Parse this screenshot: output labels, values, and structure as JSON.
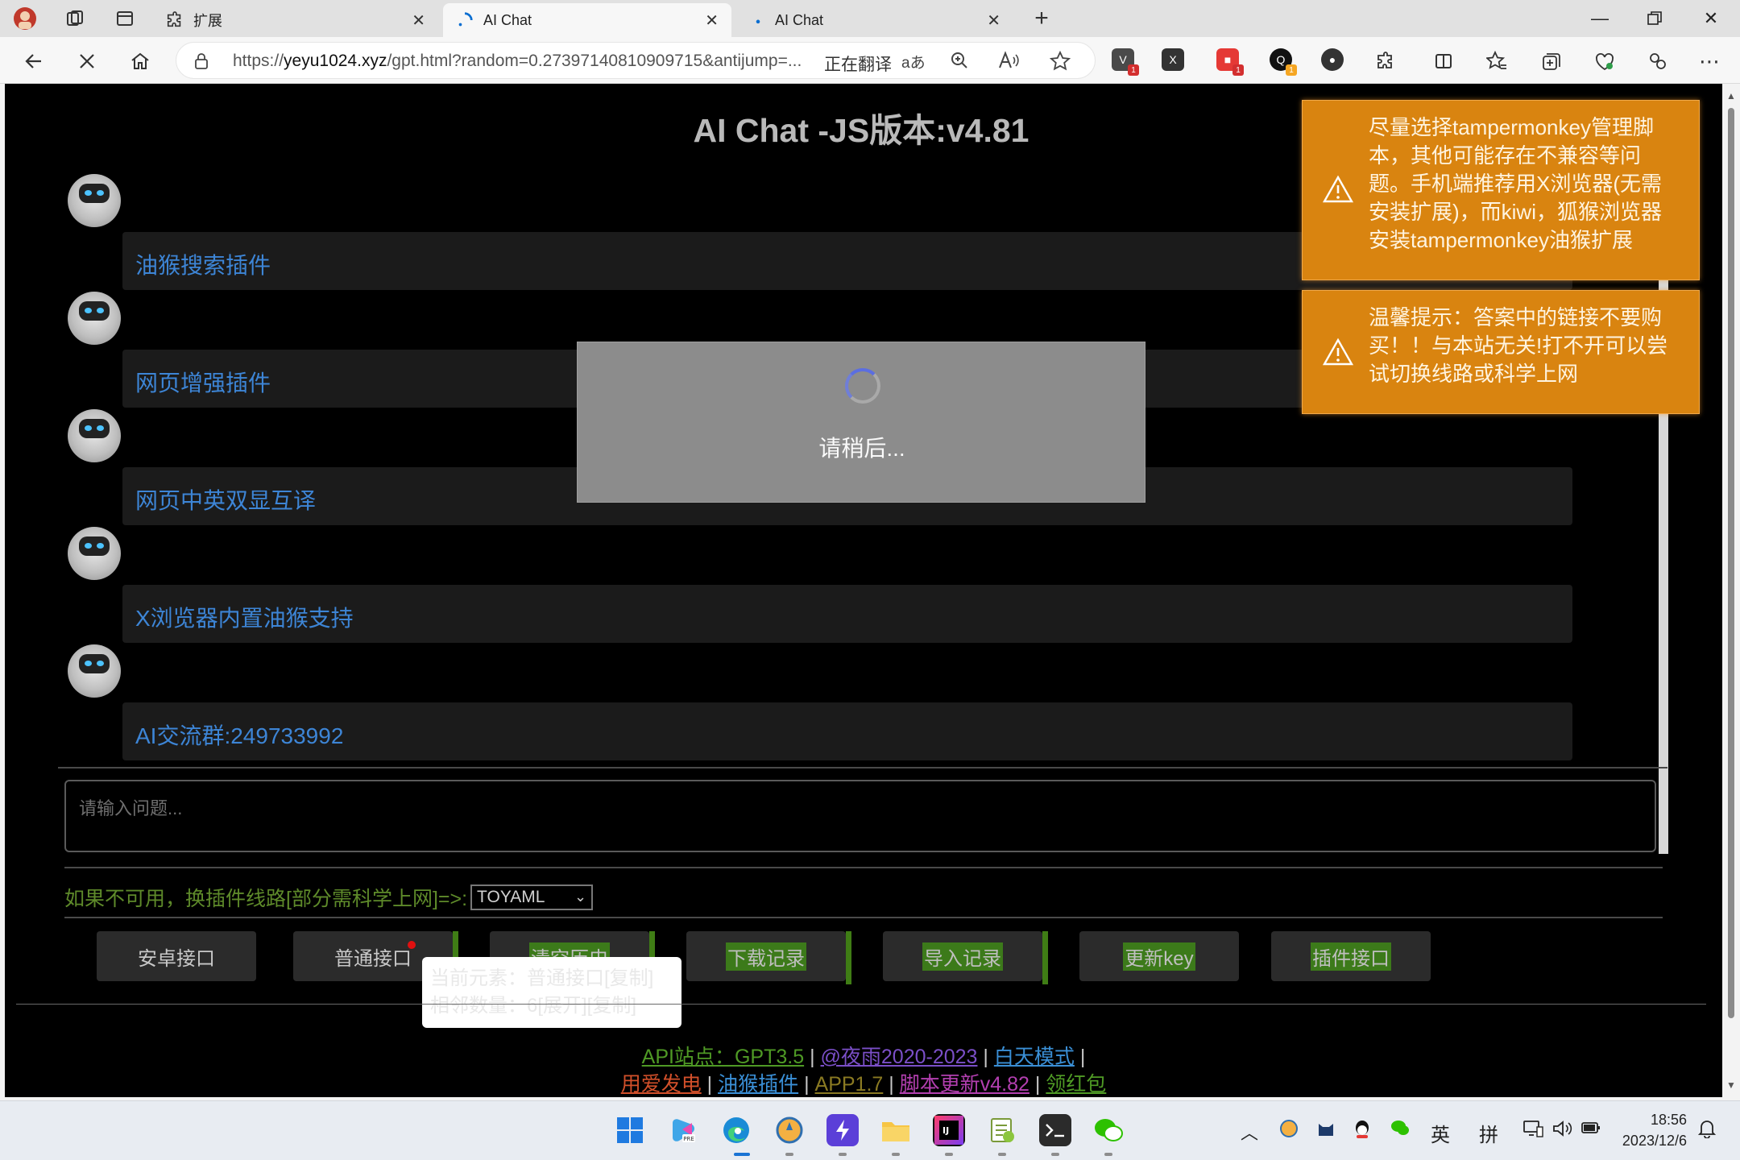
{
  "browser": {
    "tabs": [
      {
        "title": "扩展",
        "active": false
      },
      {
        "title": "AI Chat",
        "active": true
      },
      {
        "title": "AI Chat",
        "active": false
      }
    ],
    "url_prefix": "https://",
    "url_domain": "yeyu1024.xyz",
    "url_rest": "/gpt.html?random=0.27397140810909715&antijump=...",
    "translating_label": "正在翻译",
    "translate_icon_text": "aあ",
    "extensions": [
      {
        "name": "v-extension-icon",
        "glyph": "V",
        "color": "#4a4a4a",
        "badge": "1",
        "badge_color": "#d32f2f"
      },
      {
        "name": "excel-extension-icon",
        "glyph": "X",
        "color": "#333333",
        "badge": "",
        "badge_color": ""
      },
      {
        "name": "red-extension-icon",
        "glyph": "■",
        "color": "#e53935",
        "badge": "1",
        "badge_color": "#d32f2f"
      },
      {
        "name": "q-extension-icon",
        "glyph": "Q",
        "color": "#111111",
        "badge": "1",
        "badge_color": "#f5a623"
      },
      {
        "name": "round-extension-icon",
        "glyph": "●",
        "color": "#333333",
        "badge": "",
        "badge_color": ""
      }
    ]
  },
  "page": {
    "title": "AI Chat -JS版本:v4.81",
    "messages": [
      {
        "text": "油猴搜索插件"
      },
      {
        "text": "网页增强插件"
      },
      {
        "text": "网页中英双显互译"
      },
      {
        "text": "X浏览器内置油猴支持"
      },
      {
        "text": "AI交流群:249733992"
      }
    ],
    "question_placeholder": "请输入问题...",
    "route_label": "如果不可用，换插件线路[部分需科学上网]=>:",
    "route_selected": "TOYAML",
    "buttons": {
      "android": "安卓接口",
      "normal": "普通接口",
      "clear": "清空历史",
      "download": "下载记录",
      "import": "导入记录",
      "update_key": "更新key",
      "plugin": "插件接口"
    },
    "tooltip": {
      "line1": "当前元素：普通接口[复制]",
      "line2": "相邻数量：6[展开][复制]"
    },
    "footer": {
      "api": "API站点：GPT3.5",
      "author": "@夜雨2020-2023",
      "day_mode": "白天模式",
      "donate": "用爱发电",
      "tampermonkey": "油猴插件",
      "app": "APP1.7",
      "script_update": "脚本更新v4.82",
      "red_packet": "领红包",
      "sep": "|"
    },
    "loading_text": "请稍后...",
    "notices": [
      "尽量选择tampermonkey管理脚本，其他可能存在不兼容等问题。手机端推荐用X浏览器(无需安装扩展)，而kiwi，狐猴浏览器安装tampermonkey油猴扩展",
      "温馨提示：答案中的链接不要购买！！与本站无关!打不开可以尝试切换线路或科学上网"
    ]
  },
  "taskbar": {
    "ime_en": "英",
    "ime_pinyin": "拼",
    "time": "18:56",
    "date": "2023/12/6"
  },
  "colors": {
    "notice_bg": "#d98410",
    "link_blue": "#3d85d6",
    "route_green": "#5e8a2a",
    "button_highlight": "#3c7a1a"
  }
}
